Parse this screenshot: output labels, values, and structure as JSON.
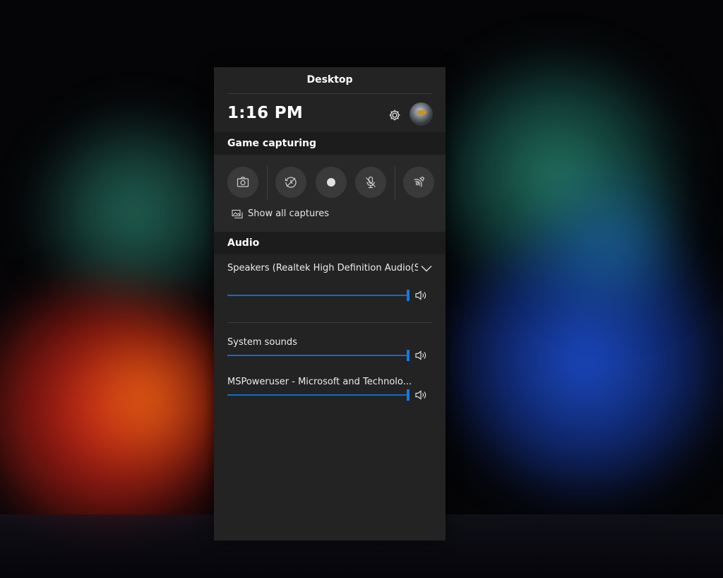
{
  "panel": {
    "title": "Desktop",
    "time": "1:16 PM",
    "settings_icon": "gear-icon",
    "avatar_icon": "user-avatar"
  },
  "capture": {
    "header": "Game capturing",
    "buttons": [
      {
        "name": "screenshot-button",
        "icon": "camera-icon"
      },
      {
        "name": "record-last-button",
        "icon": "record-history-icon"
      },
      {
        "name": "record-button",
        "icon": "record-dot-icon"
      },
      {
        "name": "mic-toggle-button",
        "icon": "mic-off-icon"
      },
      {
        "name": "broadcast-button",
        "icon": "broadcast-icon"
      }
    ],
    "show_all_label": "Show all captures"
  },
  "audio": {
    "header": "Audio",
    "device": "Speakers (Realtek High Definition Audio(SST))",
    "master_volume": 1.0,
    "apps": [
      {
        "label": "System sounds",
        "volume": 1.0
      },
      {
        "label": "MSPoweruser - Microsoft and Technolo...",
        "volume": 1.0
      }
    ]
  },
  "colors": {
    "panel_bg": "#232323",
    "accent": "#0f6bd0"
  }
}
